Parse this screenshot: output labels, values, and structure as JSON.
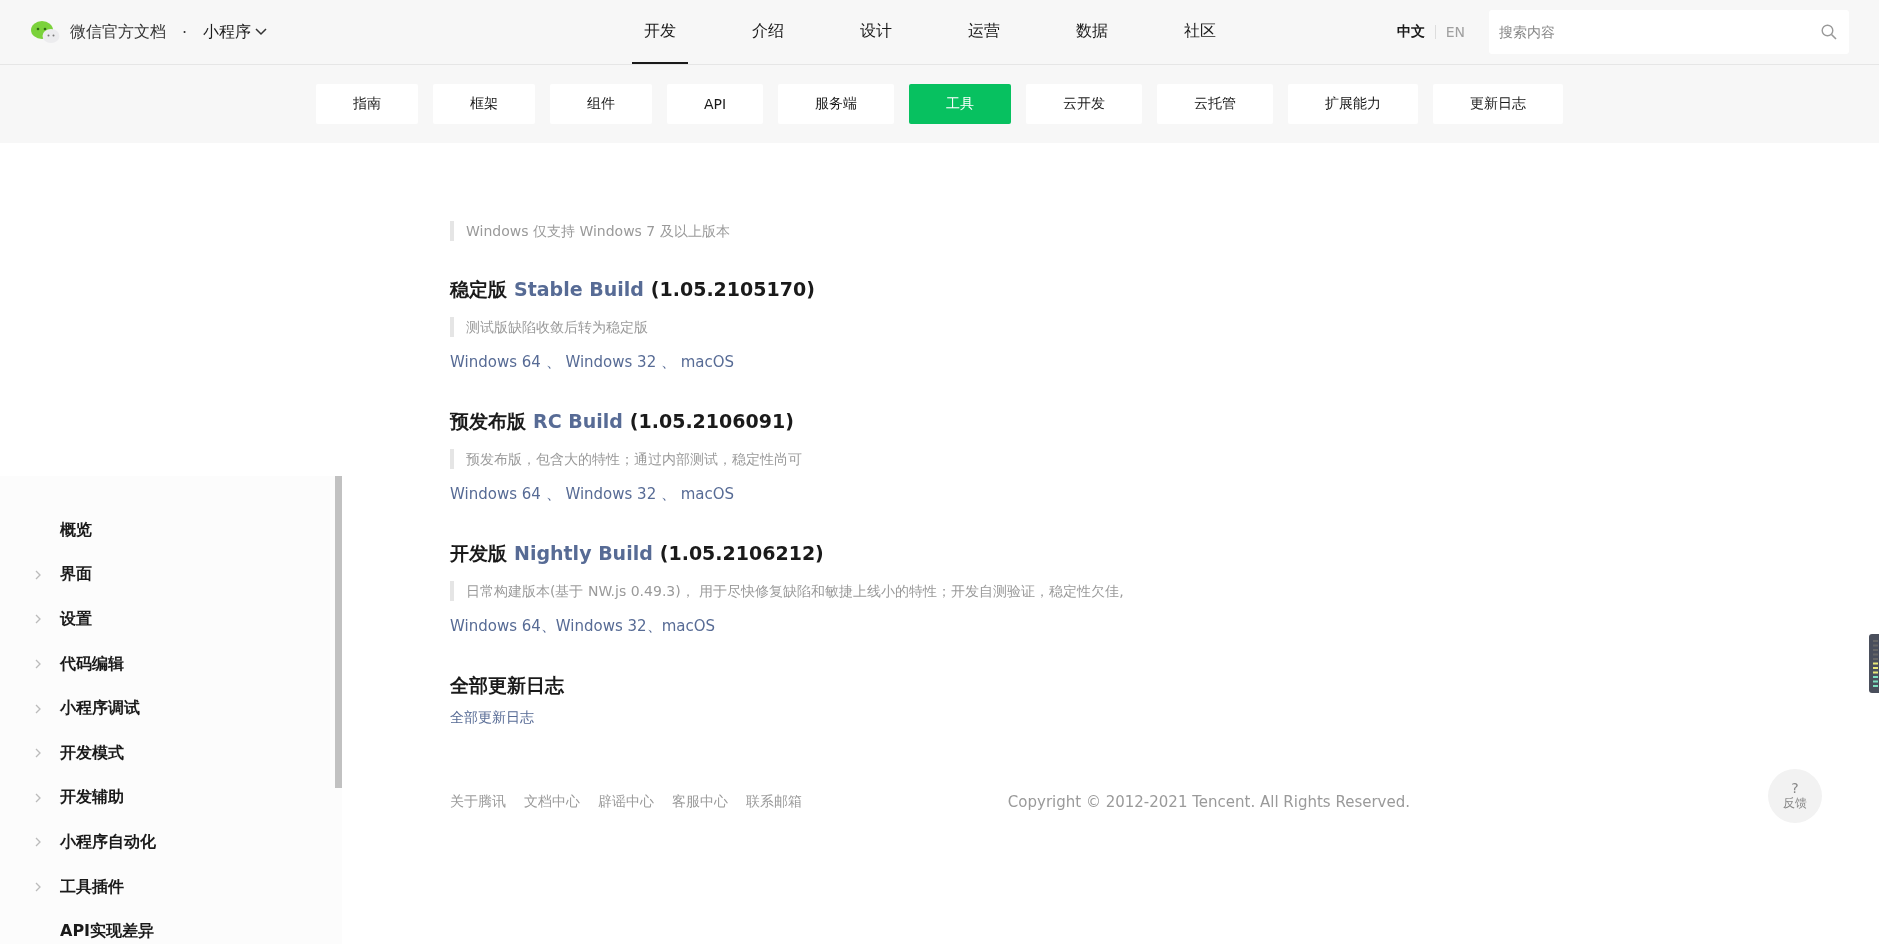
{
  "header": {
    "site_title": "微信官方文档",
    "dot": "·",
    "product": "小程序"
  },
  "nav": [
    {
      "label": "开发",
      "selected": true
    },
    {
      "label": "介绍",
      "selected": false
    },
    {
      "label": "设计",
      "selected": false
    },
    {
      "label": "运营",
      "selected": false
    },
    {
      "label": "数据",
      "selected": false
    },
    {
      "label": "社区",
      "selected": false
    }
  ],
  "languages": [
    {
      "label": "中文",
      "selected": true
    },
    {
      "label": "EN",
      "selected": false
    }
  ],
  "search": {
    "placeholder": "搜索内容"
  },
  "subnav": [
    {
      "label": "指南",
      "selected": false
    },
    {
      "label": "框架",
      "selected": false
    },
    {
      "label": "组件",
      "selected": false
    },
    {
      "label": "API",
      "selected": false
    },
    {
      "label": "服务端",
      "selected": false
    },
    {
      "label": "工具",
      "selected": true
    },
    {
      "label": "云开发",
      "selected": false
    },
    {
      "label": "云托管",
      "selected": false
    },
    {
      "label": "扩展能力",
      "selected": false
    },
    {
      "label": "更新日志",
      "selected": false
    }
  ],
  "sidebar": {
    "items": [
      {
        "label": "概览",
        "expandable": false
      },
      {
        "label": "界面",
        "expandable": true
      },
      {
        "label": "设置",
        "expandable": true
      },
      {
        "label": "代码编辑",
        "expandable": true
      },
      {
        "label": "小程序调试",
        "expandable": true
      },
      {
        "label": "开发模式",
        "expandable": true
      },
      {
        "label": "开发辅助",
        "expandable": true
      },
      {
        "label": "小程序自动化",
        "expandable": true
      },
      {
        "label": "工具插件",
        "expandable": true
      },
      {
        "label": "API实现差异",
        "expandable": false
      }
    ]
  },
  "content": {
    "intro_note": "Windows 仅支持 Windows 7 及以上版本",
    "builds": [
      {
        "label": "稳定版",
        "name": "Stable Build",
        "version": "(1.05.2105170)",
        "note": "测试版缺陷收敛后转为稳定版",
        "separator": " 、 ",
        "downloads": [
          "Windows 64",
          "Windows 32",
          "macOS"
        ]
      },
      {
        "label": "预发布版",
        "name": "RC Build",
        "version": "(1.05.2106091)",
        "note": "预发布版，包含大的特性；通过内部测试，稳定性尚可",
        "separator": " 、 ",
        "downloads": [
          "Windows 64",
          "Windows 32",
          "macOS"
        ]
      },
      {
        "label": "开发版",
        "name": "Nightly Build",
        "version": "(1.05.2106212)",
        "note": "日常构建版本(基于 NW.js 0.49.3)， 用于尽快修复缺陷和敏捷上线小的特性；开发自测验证，稳定性欠佳,",
        "separator": "、",
        "downloads": [
          "Windows 64",
          "Windows 32",
          "macOS"
        ]
      }
    ],
    "changelog": {
      "heading": "全部更新日志",
      "link": "全部更新日志"
    }
  },
  "footer": {
    "links": [
      "关于腾讯",
      "文档中心",
      "辟谣中心",
      "客服中心",
      "联系邮箱"
    ],
    "copyright": "Copyright © 2012-2021 Tencent. All Rights Reserved."
  },
  "feedback": {
    "mark": "?",
    "label": "反馈"
  }
}
